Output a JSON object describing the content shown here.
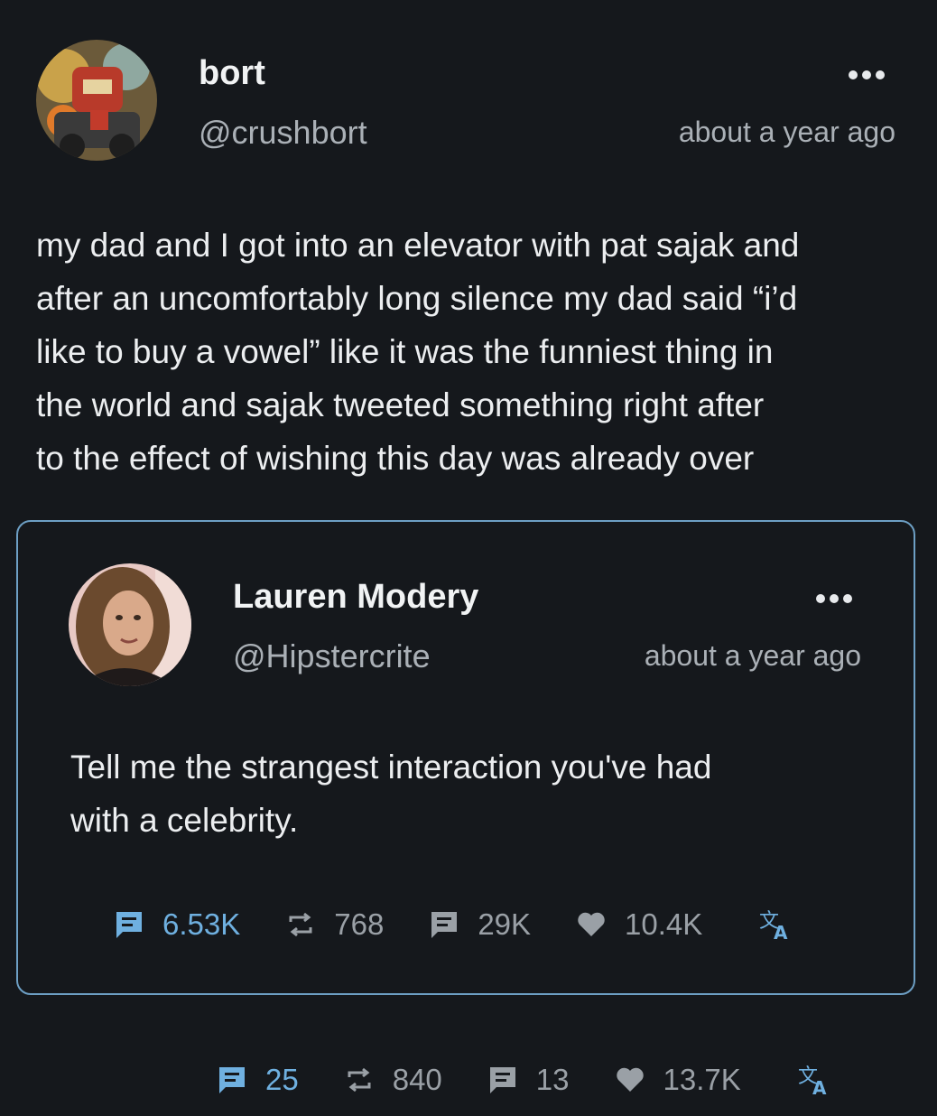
{
  "post": {
    "author_name": "bort",
    "handle": "@crushbort",
    "time": "about a year ago",
    "avatar_icon": "robot-art-avatar",
    "text_lines": [
      "my dad and I got into an elevator with pat sajak and",
      "after an uncomfortably long silence my dad said “i’d",
      "like to buy a vowel” like it was the funniest thing in",
      "the world and sajak tweeted something right after",
      "to the effect of wishing this day was already over"
    ],
    "actions": {
      "replies": "25",
      "retweets": "840",
      "quotes": "13",
      "likes": "13.7K"
    }
  },
  "quoted": {
    "author_name": "Lauren Modery",
    "handle": "@Hipstercrite",
    "time": "about a year ago",
    "avatar_icon": "woman-portrait-avatar",
    "text_lines": [
      "Tell me the strangest interaction you've had",
      "with a celebrity."
    ],
    "actions": {
      "replies": "6.53K",
      "retweets": "768",
      "quotes": "29K",
      "likes": "10.4K"
    }
  },
  "colors": {
    "background": "#15181c",
    "accent": "#6fb0e0",
    "muted": "#9aa0a6",
    "card_border": "#6d9fc4"
  }
}
